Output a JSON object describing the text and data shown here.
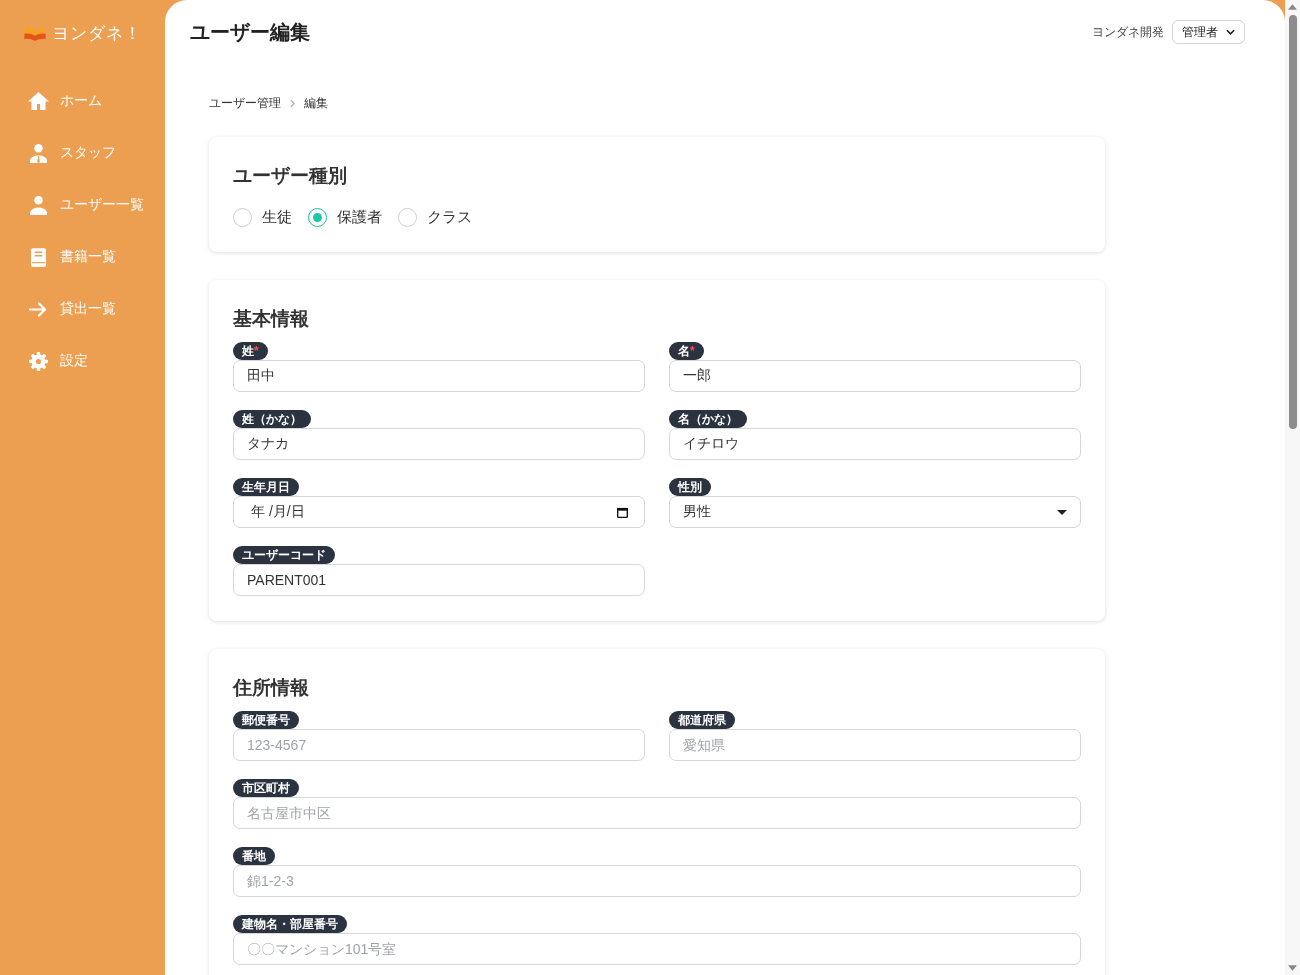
{
  "sidebar": {
    "logo": "ヨンダネ！",
    "items": [
      {
        "label": "ホーム",
        "selected": false
      },
      {
        "label": "スタッフ",
        "selected": false
      },
      {
        "label": "ユーザー一覧",
        "selected": false
      },
      {
        "label": "書籍一覧",
        "selected": false
      },
      {
        "label": "貸出一覧",
        "selected": false
      },
      {
        "label": "設定",
        "selected": false
      }
    ]
  },
  "header": {
    "title": "ユーザー編集",
    "organization": "ヨンダネ開発",
    "role_select": "管理者"
  },
  "breadcrumb": [
    "ユーザー管理",
    "編集"
  ],
  "user_type": {
    "title": "ユーザー種別",
    "options": [
      {
        "label": "生徒",
        "selected": false
      },
      {
        "label": "保護者",
        "selected": true
      },
      {
        "label": "クラス",
        "selected": false
      }
    ]
  },
  "sections": [
    {
      "title": "基本情報",
      "fields": [
        {
          "kind": "text",
          "label": "姓",
          "required_mark": "*",
          "value": "田中"
        },
        {
          "kind": "text",
          "label": "名",
          "required_mark": "*",
          "value": "一郎"
        },
        {
          "kind": "text",
          "label": "姓（かな）",
          "value": "タナカ"
        },
        {
          "kind": "text",
          "label": "名（かな）",
          "value": "イチロウ"
        },
        {
          "kind": "date",
          "label": "生年月日",
          "value": "年 /月/日"
        },
        {
          "kind": "select",
          "label": "性別",
          "value": "男性"
        },
        {
          "kind": "text",
          "label": "ユーザーコード",
          "value": "PARENT001"
        }
      ]
    },
    {
      "title": "住所情報",
      "fields": [
        {
          "kind": "text",
          "label": "郵便番号",
          "placeholder": "123-4567"
        },
        {
          "kind": "text",
          "label": "都道府県",
          "placeholder": "愛知県"
        },
        {
          "kind": "text",
          "label": "市区町村",
          "placeholder": "名古屋市中区",
          "wide": true
        },
        {
          "kind": "text",
          "label": "番地",
          "placeholder": "錦1-2-3",
          "wide": true
        },
        {
          "kind": "text",
          "label": "建物名・部屋番号",
          "placeholder": "〇〇マンション101号室",
          "wide": true
        }
      ]
    }
  ]
}
